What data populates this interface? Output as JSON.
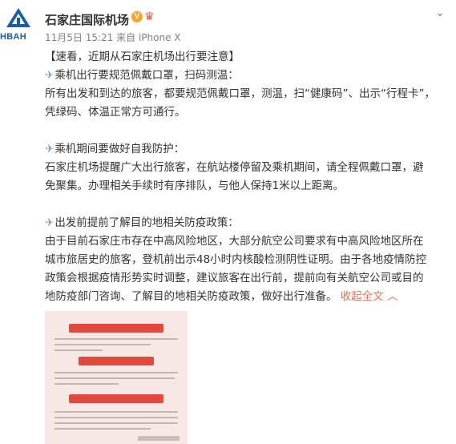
{
  "post": {
    "username": "石家庄国际机场",
    "vip_badge": "V",
    "timestamp": "11月5日 15:21",
    "source": "来自 iPhone X",
    "more_icon": "chevron-down-icon",
    "avatar": {
      "label": "HBAH",
      "brand_color": "#1d5aa8"
    }
  },
  "content": {
    "title": "【速看，近期从石家庄机场出行要注意】",
    "section1_heading": "乘机出行要规范佩戴口罩，扫码测温：",
    "section1_line1": "所有出发和到达的旅客，都要规范佩戴口罩，测温，扫“健康码”、出示“行程卡”，",
    "section1_line2": "凭绿码、体温正常方可通行。",
    "section2_heading": "乘机期间要做好自我防护：",
    "section2_line1": "石家庄机场提醒广大出行旅客，在航站楼停留及乘机期间，请全程佩戴口罩，避",
    "section2_line2": "免聚集。办理相关手续时有序排队，与他人保持1米以上距离。",
    "section3_heading": "出发前提前了解目的地相关防疫政策：",
    "section3_line1": "由于目前石家庄市存在中高风险地区，大部分航空公司要求有中高风险地区所在",
    "section3_line2": "城市旅居史的旅客，登机前出示48小时内核酸检测阴性证明。由于各地疫情防控",
    "section3_line3": "政策会根据疫情形势实时调整，建议旅客在出行前，提前向有关航空公司或目的",
    "section3_line4": "地防疫部门咨询、了解目的地相关防疫政策，做好出行准备。",
    "collapse_label": "收起全文",
    "collapse_icon": "chevron-up-icon"
  },
  "colors": {
    "link": "#eb7350",
    "banner": "#e2493d",
    "card_bg": "#f7e7e5"
  }
}
